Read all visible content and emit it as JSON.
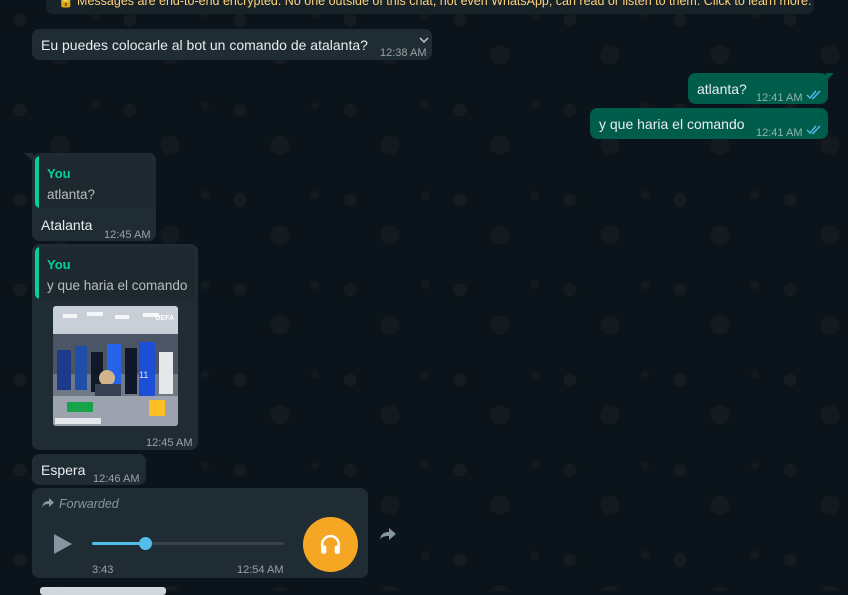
{
  "banner": {
    "text": "Messages are end-to-end encrypted. No one outside of this chat, not even WhatsApp, can read or listen to them. Click to learn more."
  },
  "messages": [
    {
      "text": "Eu puedes colocarle al bot un comando de atalanta?",
      "time": "12:38 AM"
    },
    {
      "text": "atlanta?",
      "time": "12:41 AM"
    },
    {
      "text": "y que haria el comando",
      "time": "12:41 AM"
    },
    {
      "quote_author": "You",
      "quote_text": "atlanta?",
      "text": "Atalanta",
      "time": "12:45 AM"
    },
    {
      "quote_author": "You",
      "quote_text": "y que haria el comando",
      "time": "12:45 AM",
      "media_watermark": "UEFA"
    },
    {
      "text": "Espera",
      "time": "12:46 AM"
    },
    {
      "forwarded_label": "Forwarded",
      "duration": "3:43",
      "time": "12:54 AM",
      "progress": 0.28
    }
  ],
  "colors": {
    "background": "#0b141a",
    "incoming": "#202c33",
    "outgoing": "#005c4b",
    "quote_accent": "#06cf9c",
    "read_tick": "#53bdeb",
    "audio_avatar": "#f5a623"
  },
  "icons": [
    "chevron-down-icon",
    "double-check-icon",
    "forward-arrow-icon",
    "play-icon",
    "headphones-icon",
    "share-icon"
  ]
}
